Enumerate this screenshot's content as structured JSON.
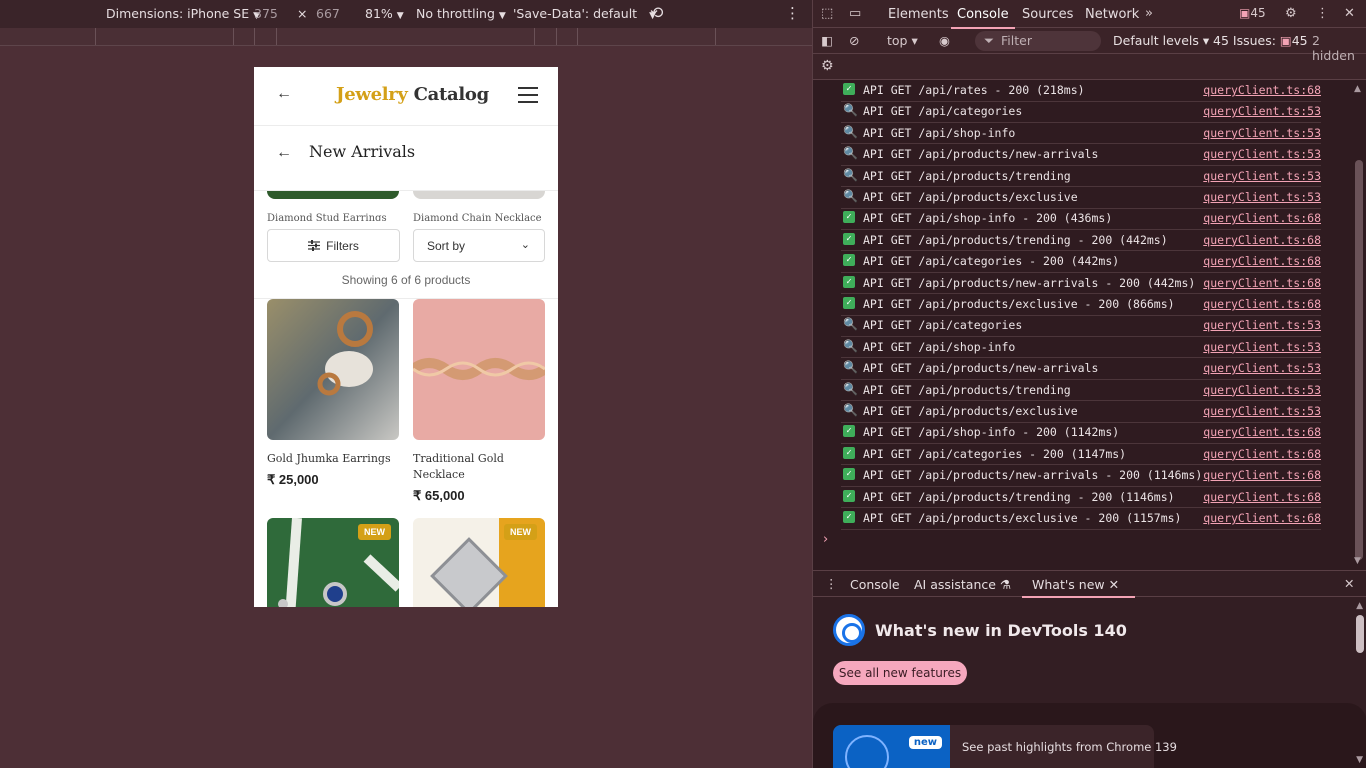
{
  "device_toolbar": {
    "dimensions_label": "Dimensions: iPhone SE",
    "width": "375",
    "x_sep": "×",
    "height": "667",
    "zoom": "81%",
    "throttling": "No throttling",
    "save_data": "'Save-Data': default"
  },
  "app": {
    "brand_gold": "Jewelry",
    "brand_dark": "Catalog",
    "page_title": "New Arrivals",
    "peek_items": [
      "Diamond Stud Earrings",
      "Diamond Chain Necklace"
    ],
    "filters_label": "Filters",
    "sort_label": "Sort by",
    "showing": "Showing 6 of 6 products",
    "products": [
      {
        "name": "Gold Jhumka Earrings",
        "price": "₹ 25,000"
      },
      {
        "name": "Traditional Gold Necklace",
        "price": "₹ 65,000"
      },
      {
        "badge": "NEW"
      },
      {
        "badge": "NEW"
      }
    ]
  },
  "devtools": {
    "tabs": [
      "Elements",
      "Console",
      "Sources",
      "Network"
    ],
    "active_tab": "Console",
    "issues_count": "45",
    "toolbar": {
      "context": "top",
      "filter_placeholder": "Filter",
      "levels": "Default levels",
      "issues": "45 Issues:",
      "issues_count": "45",
      "hidden": "2 hidden"
    },
    "logs": [
      {
        "type": "ok",
        "msg": "API GET /api/rates - 200 (218ms)",
        "src": "queryClient.ts:68"
      },
      {
        "type": "q",
        "msg": "API GET /api/categories",
        "src": "queryClient.ts:53"
      },
      {
        "type": "q",
        "msg": "API GET /api/shop-info",
        "src": "queryClient.ts:53"
      },
      {
        "type": "q",
        "msg": "API GET /api/products/new-arrivals",
        "src": "queryClient.ts:53"
      },
      {
        "type": "q",
        "msg": "API GET /api/products/trending",
        "src": "queryClient.ts:53"
      },
      {
        "type": "q",
        "msg": "API GET /api/products/exclusive",
        "src": "queryClient.ts:53"
      },
      {
        "type": "ok",
        "msg": "API GET /api/shop-info - 200 (436ms)",
        "src": "queryClient.ts:68"
      },
      {
        "type": "ok",
        "msg": "API GET /api/products/trending - 200 (442ms)",
        "src": "queryClient.ts:68"
      },
      {
        "type": "ok",
        "msg": "API GET /api/categories - 200 (442ms)",
        "src": "queryClient.ts:68"
      },
      {
        "type": "ok",
        "msg": "API GET /api/products/new-arrivals - 200 (442ms)",
        "src": "queryClient.ts:68"
      },
      {
        "type": "ok",
        "msg": "API GET /api/products/exclusive - 200 (866ms)",
        "src": "queryClient.ts:68"
      },
      {
        "type": "q",
        "msg": "API GET /api/categories",
        "src": "queryClient.ts:53"
      },
      {
        "type": "q",
        "msg": "API GET /api/shop-info",
        "src": "queryClient.ts:53"
      },
      {
        "type": "q",
        "msg": "API GET /api/products/new-arrivals",
        "src": "queryClient.ts:53"
      },
      {
        "type": "q",
        "msg": "API GET /api/products/trending",
        "src": "queryClient.ts:53"
      },
      {
        "type": "q",
        "msg": "API GET /api/products/exclusive",
        "src": "queryClient.ts:53"
      },
      {
        "type": "ok",
        "msg": "API GET /api/shop-info - 200 (1142ms)",
        "src": "queryClient.ts:68"
      },
      {
        "type": "ok",
        "msg": "API GET /api/categories - 200 (1147ms)",
        "src": "queryClient.ts:68"
      },
      {
        "type": "ok",
        "msg": "API GET /api/products/new-arrivals - 200 (1146ms)",
        "src": "queryClient.ts:68"
      },
      {
        "type": "ok",
        "msg": "API GET /api/products/trending - 200 (1146ms)",
        "src": "queryClient.ts:68"
      },
      {
        "type": "ok",
        "msg": "API GET /api/products/exclusive - 200 (1157ms)",
        "src": "queryClient.ts:68"
      }
    ],
    "drawer": {
      "tabs": [
        "Console",
        "AI assistance",
        "What's new"
      ],
      "title": "What's new in DevTools 140",
      "button": "See all new features",
      "badge": "new",
      "card_text": "See past highlights from Chrome 139"
    }
  },
  "colors": {
    "accent_gold": "#d4a017",
    "devtools_accent": "#f3a3b5",
    "success_green": "#3fae5a"
  }
}
